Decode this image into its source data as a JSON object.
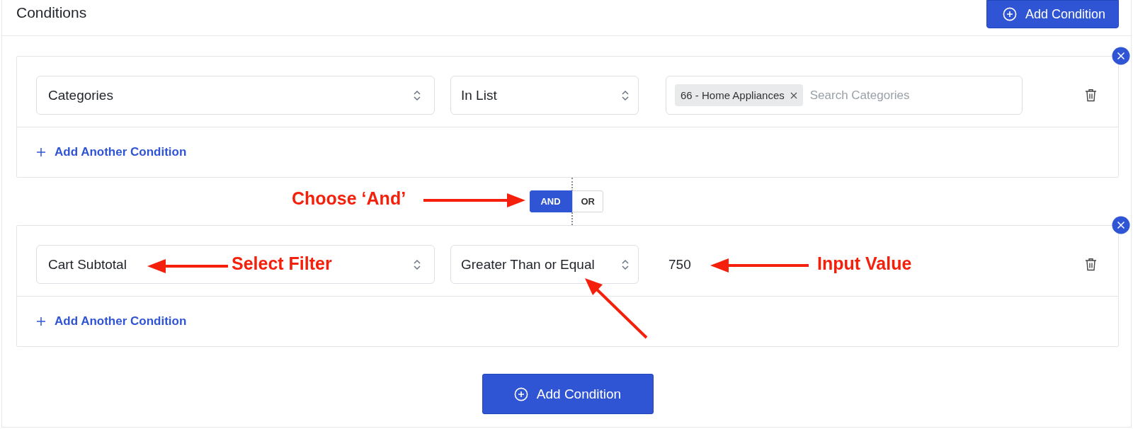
{
  "header": {
    "title": "Conditions",
    "add_button": "Add Condition"
  },
  "groups": [
    {
      "row": {
        "field": "Categories",
        "operator": "In List",
        "value": {
          "kind": "tags",
          "tags": [
            "66 - Home Appliances"
          ],
          "placeholder": "Search Categories"
        }
      },
      "add_link": "Add Another Condition"
    },
    {
      "row": {
        "field": "Cart Subtotal",
        "operator": "Greater Than or Equal",
        "value": {
          "kind": "text",
          "value": "750"
        }
      },
      "add_link": "Add Another Condition"
    }
  ],
  "logic_toggle": [
    {
      "label": "AND",
      "selected": true
    },
    {
      "label": "OR",
      "selected": false
    }
  ],
  "footer_button": "Add Condition",
  "annotations": [
    {
      "text": "Choose ‘And’"
    },
    {
      "text": "Select Filter"
    },
    {
      "text": "Input Value"
    }
  ]
}
